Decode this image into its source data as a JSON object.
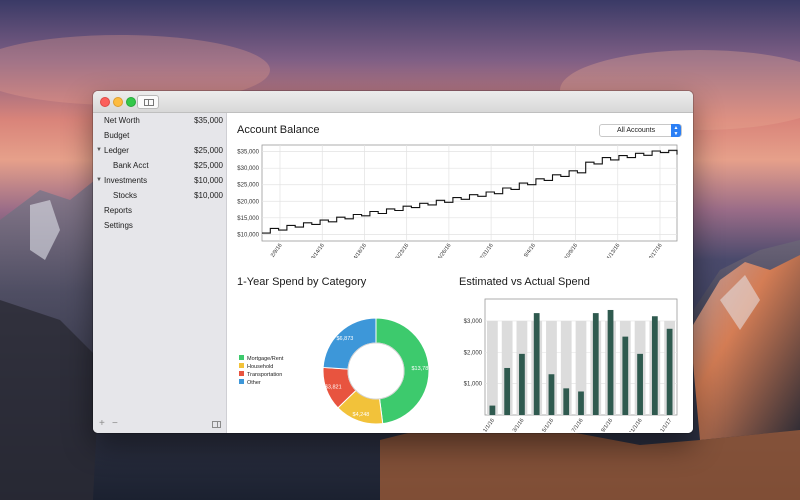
{
  "sidebar": {
    "items": [
      {
        "label": "Net Worth",
        "amount": "$35,000"
      },
      {
        "label": "Budget",
        "amount": ""
      },
      {
        "label": "Ledger",
        "amount": "$25,000"
      },
      {
        "label": "Bank Acct",
        "amount": "$25,000"
      },
      {
        "label": "Investments",
        "amount": "$10,000"
      },
      {
        "label": "Stocks",
        "amount": "$10,000"
      },
      {
        "label": "Reports",
        "amount": ""
      },
      {
        "label": "Settings",
        "amount": ""
      }
    ],
    "footer": {
      "add_label": "+",
      "remove_label": "−"
    }
  },
  "account_filter": {
    "selected": "All Accounts"
  },
  "colors": {
    "line": "#111111",
    "mortgage": "#3dca6d",
    "household": "#f2c23a",
    "transportation": "#e8543f",
    "other": "#3d97d9",
    "estimated": "#dcdcdc",
    "actual": "#2f5a4f"
  },
  "chart_data": [
    {
      "type": "line",
      "title": "Account Balance",
      "xlabel": "",
      "ylabel": "",
      "y_ticks": [
        "$35,000",
        "$30,000",
        "$25,000",
        "$20,000",
        "$15,000",
        "$10,000"
      ],
      "x_ticks": [
        "2/9/16",
        "3/14/16",
        "4/18/16",
        "5/23/16",
        "6/26/16",
        "7/31/16",
        "9/4/16",
        "10/9/16",
        "11/13/16",
        "12/17/16"
      ],
      "ylim": [
        8000,
        37000
      ],
      "grid": true,
      "series": [
        {
          "x": [
            0,
            1,
            2,
            3,
            4,
            5,
            6,
            7,
            8,
            9,
            10,
            11,
            12,
            13,
            14,
            15,
            16,
            17,
            18,
            19,
            20,
            21,
            22,
            23,
            24,
            25,
            26,
            27,
            28,
            29,
            30,
            31,
            32,
            33,
            34,
            35,
            36,
            37,
            38,
            39,
            40,
            41,
            42,
            43,
            44,
            45,
            46,
            47,
            48,
            49,
            50
          ],
          "y": [
            10400,
            11800,
            11300,
            12700,
            12200,
            13500,
            13000,
            14300,
            13800,
            15200,
            14700,
            16000,
            15600,
            16900,
            16300,
            17700,
            17200,
            18500,
            18100,
            19400,
            18900,
            20300,
            19700,
            21100,
            20600,
            22000,
            21500,
            22800,
            22300,
            24000,
            23600,
            25500,
            25000,
            26800,
            26300,
            28000,
            27500,
            29200,
            28600,
            31800,
            31300,
            33200,
            32500,
            33800,
            33200,
            34500,
            33900,
            35200,
            34700,
            35400,
            34100
          ]
        }
      ]
    },
    {
      "type": "pie",
      "title": "1-Year Spend by Category",
      "categories": [
        "Mortgage/Rent",
        "Household",
        "Transportation",
        "Other"
      ],
      "values": [
        13780,
        4248,
        3821,
        6873
      ],
      "labels": [
        "$13,780",
        "$4,248",
        "$3,821",
        "$6,873"
      ]
    },
    {
      "type": "bar",
      "title": "Estimated vs Actual Spend",
      "categories": [
        "1/1/16",
        "2/1/16",
        "3/1/16",
        "4/1/16",
        "5/1/16",
        "6/1/16",
        "7/1/16",
        "8/1/16",
        "9/1/16",
        "10/1/16",
        "11/1/16",
        "12/1/16",
        "1/1/17"
      ],
      "x_tick_labels": [
        "1/1/16",
        "3/1/16",
        "5/1/16",
        "7/1/16",
        "9/1/16",
        "11/1/16",
        "1/1/17"
      ],
      "y_ticks": [
        "$3,000",
        "$2,000",
        "$1,000"
      ],
      "ylim": [
        0,
        3700
      ],
      "series": [
        {
          "values": [
            3000,
            3000,
            3000,
            3000,
            3000,
            3000,
            3000,
            3000,
            3000,
            3000,
            3000,
            3000,
            3000
          ]
        },
        {
          "values": [
            300,
            1500,
            1950,
            3250,
            1300,
            850,
            750,
            3250,
            3350,
            2500,
            1950,
            3150,
            2750
          ]
        }
      ]
    }
  ]
}
